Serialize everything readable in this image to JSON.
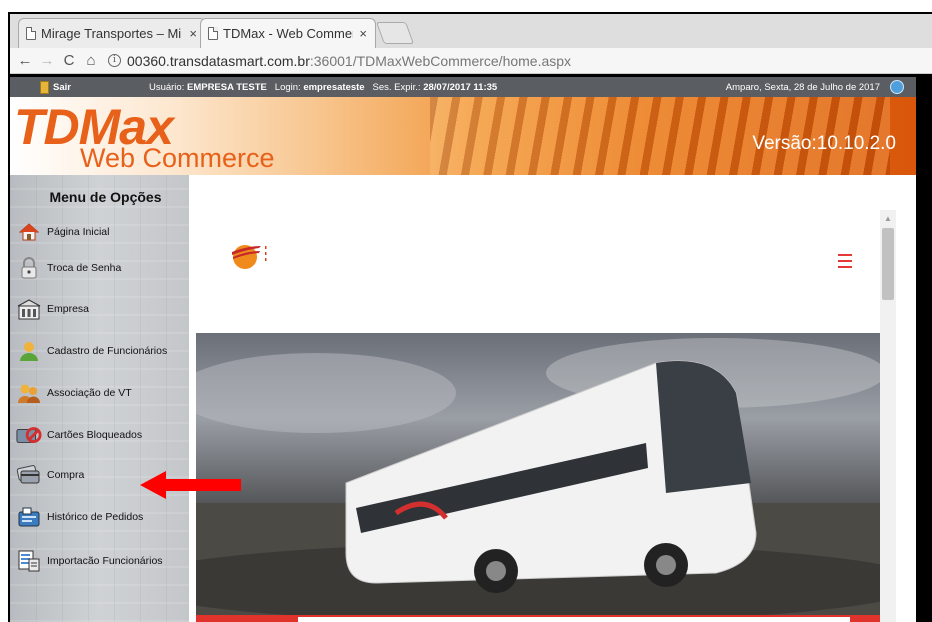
{
  "browser": {
    "tabs": [
      {
        "title": "Mirage Transportes – Mi",
        "close": "×",
        "active": false
      },
      {
        "title": "TDMax - Web Commerc",
        "close": "×",
        "active": true
      }
    ],
    "nav": {
      "back": "←",
      "forward": "→",
      "reload": "C",
      "home": "⌂"
    },
    "url": {
      "host": "00360.transdatasmart.com.br",
      "path": ":36001/TDMaxWebCommerce/home.aspx"
    }
  },
  "statusbar": {
    "logout": "Sair",
    "user_label": "Usuário:",
    "user_value": "EMPRESA TESTE",
    "login_label": "Login:",
    "login_value": "empresateste",
    "expiry_label": "Ses. Expir.:",
    "expiry_value": "28/07/2017 11:35",
    "date": "Amparo, Sexta, 28 de Julho de 2017"
  },
  "banner": {
    "logo_main": "TDMax",
    "logo_sub": "Web Commerce",
    "version": "Versão:10.10.2.0"
  },
  "sidebar": {
    "title": "Menu de Opções",
    "items": [
      {
        "label": "Página Inicial",
        "icon": "home-icon"
      },
      {
        "label": "Troca de Senha",
        "icon": "lock-icon"
      },
      {
        "label": "Empresa",
        "icon": "building-icon"
      },
      {
        "label": "Cadastro de Funcionários",
        "icon": "user-icon"
      },
      {
        "label": "Associação de VT",
        "icon": "users-icon"
      },
      {
        "label": "Cartões Bloqueados",
        "icon": "blocked-card-icon"
      },
      {
        "label": "Compra",
        "icon": "cards-icon"
      },
      {
        "label": "Histórico de Pedidos",
        "icon": "history-icon"
      },
      {
        "label": "Importacão Funcionários",
        "icon": "import-icon"
      }
    ]
  },
  "colors": {
    "accent": "#e8611a",
    "menu_red": "#e53935",
    "status_bg": "#5a5d61"
  }
}
